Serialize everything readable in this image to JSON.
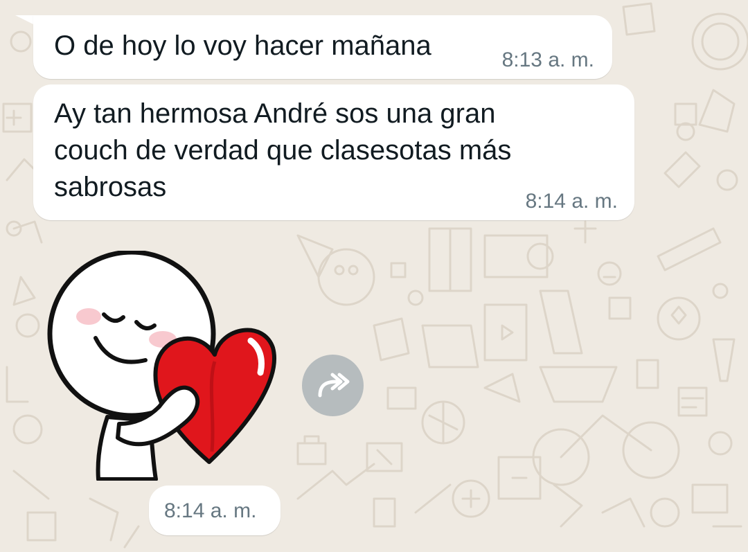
{
  "theme": {
    "wallpaper_color": "#efeae2",
    "bubble_color": "#ffffff",
    "text_color": "#111b21",
    "time_color": "#667781",
    "forward_button_color": "#8696a0"
  },
  "messages": [
    {
      "text": "O de hoy lo voy hacer mañana",
      "time": "8:13 a. m."
    },
    {
      "text": "Ay tan hermosa André sos una gran\ncouch de verdad que clasesotas más\nsabrosas",
      "time": "8:14 a. m."
    }
  ],
  "sticker_message": {
    "sticker": "hugging-heart-sticker",
    "forward_icon": "forward-arrow-icon",
    "time": "8:14 a. m."
  }
}
